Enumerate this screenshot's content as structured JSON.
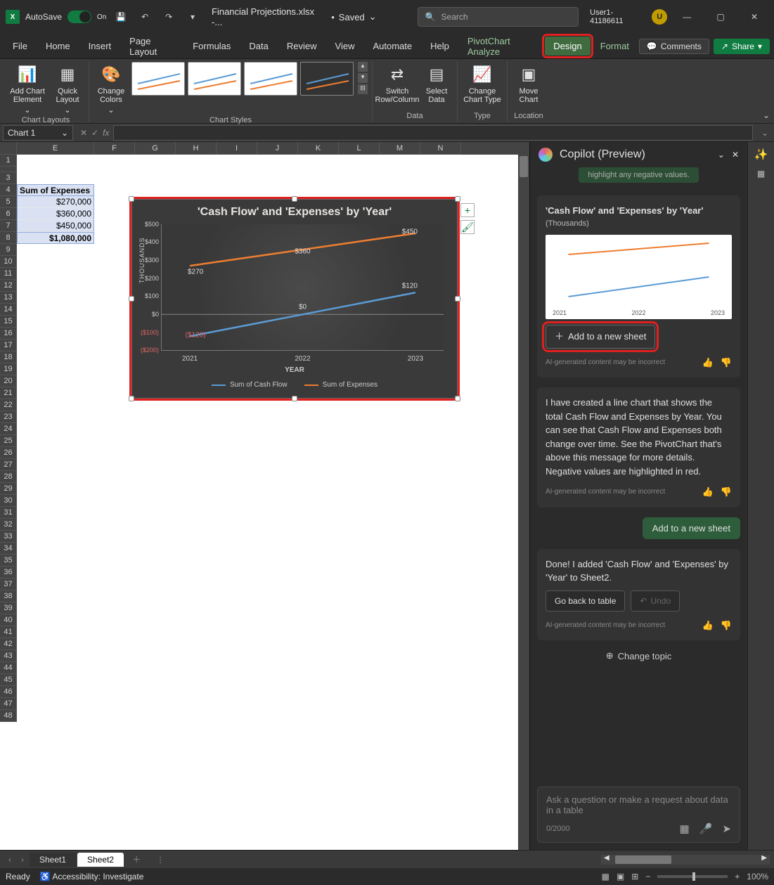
{
  "titlebar": {
    "autosave_label": "AutoSave",
    "autosave_state": "On",
    "filename": "Financial Projections.xlsx -...",
    "save_status": "Saved",
    "search_placeholder": "Search",
    "username": "User1-41186611",
    "user_initial": "U"
  },
  "ribbon_tabs": {
    "file": "File",
    "home": "Home",
    "insert": "Insert",
    "page_layout": "Page Layout",
    "formulas": "Formulas",
    "data": "Data",
    "review": "Review",
    "view": "View",
    "automate": "Automate",
    "help": "Help",
    "pivot": "PivotChart Analyze",
    "design": "Design",
    "format": "Format",
    "comments": "Comments",
    "share": "Share"
  },
  "ribbon": {
    "add_chart_element": "Add Chart Element",
    "quick_layout": "Quick Layout",
    "change_colors": "Change Colors",
    "switch_row_col": "Switch Row/Column",
    "select_data": "Select Data",
    "change_chart_type": "Change Chart Type",
    "move_chart": "Move Chart",
    "grp_layouts": "Chart Layouts",
    "grp_styles": "Chart Styles",
    "grp_data": "Data",
    "grp_type": "Type",
    "grp_location": "Location"
  },
  "formula_bar": {
    "name_box": "Chart 1"
  },
  "grid": {
    "columns": [
      "E",
      "F",
      "G",
      "H",
      "I",
      "J",
      "K",
      "L",
      "M",
      "N"
    ],
    "header_cell": "Sum of Expenses",
    "rows": [
      "$270,000",
      "$360,000",
      "$450,000"
    ],
    "total": "$1,080,000"
  },
  "chart_data": {
    "type": "line",
    "title": "'Cash Flow' and 'Expenses' by 'Year'",
    "xlabel": "YEAR",
    "ylabel": "THOUSANDS",
    "categories": [
      "2021",
      "2022",
      "2023"
    ],
    "y_ticks": [
      "($200)",
      "($100)",
      "$0",
      "$100",
      "$200",
      "$300",
      "$400",
      "$500"
    ],
    "ylim": [
      -200,
      500
    ],
    "series": [
      {
        "name": "Sum of Cash Flow",
        "values": [
          -120,
          0,
          120
        ],
        "labels": [
          "($120)",
          "$0",
          "$120"
        ],
        "color": "#5b9bd5"
      },
      {
        "name": "Sum of Expenses",
        "values": [
          270,
          360,
          450
        ],
        "labels": [
          "$270",
          "$360",
          "$450"
        ],
        "color": "#ed7d31"
      }
    ]
  },
  "copilot": {
    "title": "Copilot (Preview)",
    "truncated": "highlight any negative values.",
    "card_title": "'Cash Flow' and 'Expenses' by 'Year'",
    "card_sub": "(Thousands)",
    "mini_x": [
      "2021",
      "2022",
      "2023"
    ],
    "add_to_sheet": "Add to a new sheet",
    "disclaimer": "AI-generated content may be incorrect",
    "msg2": "I have created a line chart that shows the total Cash Flow and Expenses by Year. You can see that Cash Flow and Expenses both change over time. See the PivotChart that's above this message for more details. Negative values are highlighted in red.",
    "user_msg": "Add to a new sheet",
    "msg3": "Done! I added 'Cash Flow' and 'Expenses' by 'Year' to Sheet2.",
    "go_back": "Go back to table",
    "undo": "Undo",
    "change_topic": "Change topic",
    "input_placeholder": "Ask a question or make a request about data in a table",
    "char_count": "0/2000"
  },
  "sheets": {
    "s1": "Sheet1",
    "s2": "Sheet2"
  },
  "status": {
    "ready": "Ready",
    "accessibility": "Accessibility: Investigate",
    "zoom": "100%"
  }
}
